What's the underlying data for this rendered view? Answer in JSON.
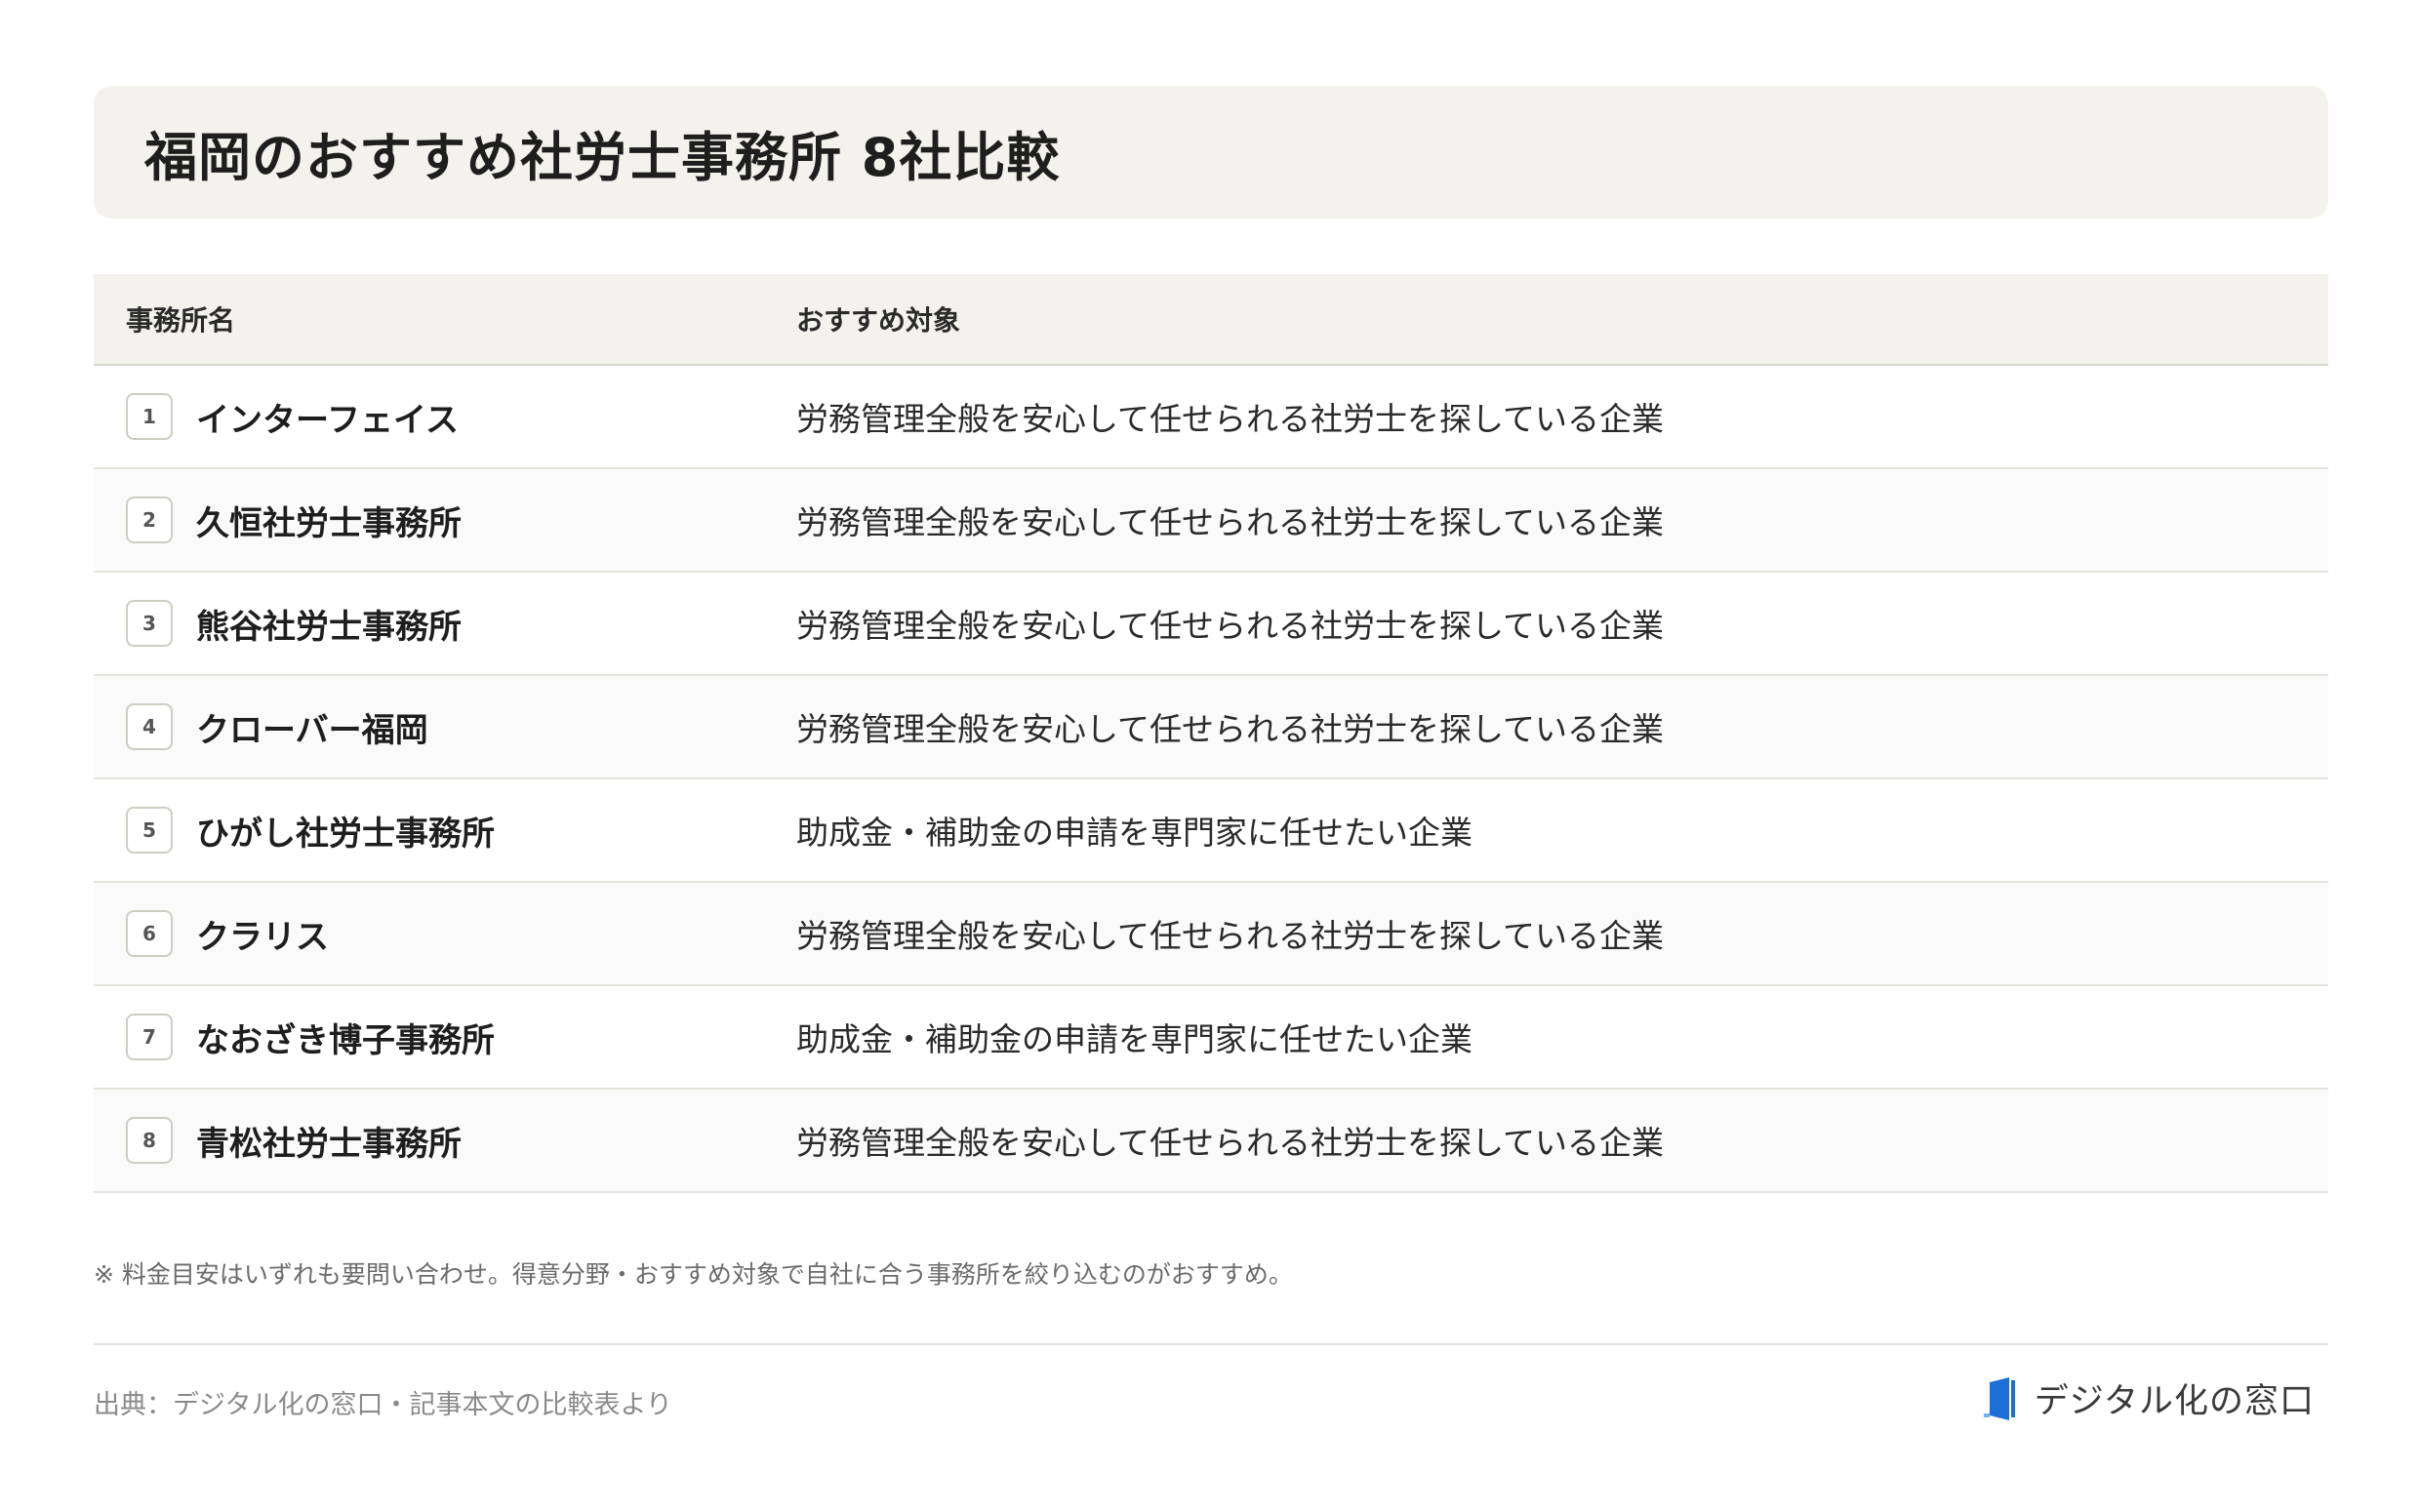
{
  "header": {
    "title": "福岡のおすすめ社労士事務所 8社比較"
  },
  "table": {
    "columns": [
      "事務所名",
      "おすすめ対象"
    ],
    "rows": [
      {
        "num": "1",
        "name": "インターフェイス",
        "target": "労務管理全般を安心して任せられる社労士を探している企業"
      },
      {
        "num": "2",
        "name": "久恒社労士事務所",
        "target": "労務管理全般を安心して任せられる社労士を探している企業"
      },
      {
        "num": "3",
        "name": "熊谷社労士事務所",
        "target": "労務管理全般を安心して任せられる社労士を探している企業"
      },
      {
        "num": "4",
        "name": "クローバー福岡",
        "target": "労務管理全般を安心して任せられる社労士を探している企業"
      },
      {
        "num": "5",
        "name": "ひがし社労士事務所",
        "target": "助成金・補助金の申請を専門家に任せたい企業"
      },
      {
        "num": "6",
        "name": "クラリス",
        "target": "労務管理全般を安心して任せられる社労士を探している企業"
      },
      {
        "num": "7",
        "name": "なおざき博子事務所",
        "target": "助成金・補助金の申請を専門家に任せたい企業"
      },
      {
        "num": "8",
        "name": "青松社労士事務所",
        "target": "労務管理全般を安心して任せられる社労士を探している企業"
      }
    ]
  },
  "footer": {
    "note": "※ 料金目安はいずれも要問い合わせ。得意分野・おすすめ対象で自社に合う事務所を絞り込むのがおすすめ。",
    "source": "出典：デジタル化の窓口・記事本文の比較表より",
    "brand_name": "デジタル化の窓口",
    "brand_icon": "door-logo-icon",
    "brand_color": "#1d6fd6"
  }
}
